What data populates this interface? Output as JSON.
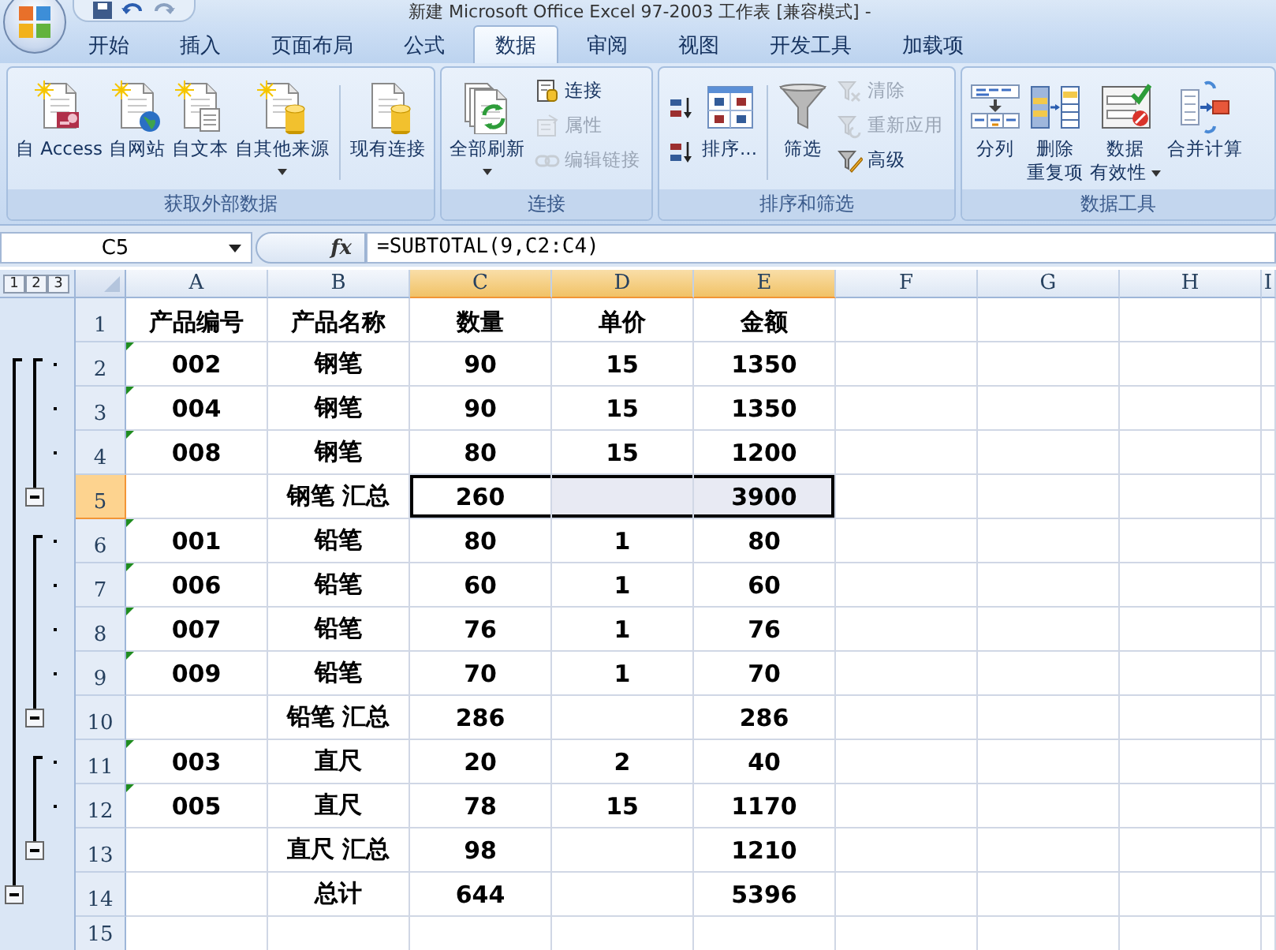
{
  "window": {
    "title": "新建 Microsoft Office Excel 97-2003 工作表 [兼容模式] -"
  },
  "tabs": [
    {
      "label": "开始",
      "selected": false
    },
    {
      "label": "插入",
      "selected": false
    },
    {
      "label": "页面布局",
      "selected": false
    },
    {
      "label": "公式",
      "selected": false
    },
    {
      "label": "数据",
      "selected": true
    },
    {
      "label": "审阅",
      "selected": false
    },
    {
      "label": "视图",
      "selected": false
    },
    {
      "label": "开发工具",
      "selected": false
    },
    {
      "label": "加载项",
      "selected": false
    }
  ],
  "ribbon_groups": [
    {
      "label": "获取外部数据",
      "items": [
        {
          "kind": "large",
          "label": [
            "自 Access"
          ],
          "dropdown": false
        },
        {
          "kind": "large",
          "label": [
            "自网站"
          ],
          "dropdown": false
        },
        {
          "kind": "large",
          "label": [
            "自文本"
          ],
          "dropdown": false
        },
        {
          "kind": "large",
          "label": [
            "自其他来源"
          ],
          "dropdown": true
        },
        {
          "kind": "large",
          "label": [
            "现有连接"
          ],
          "dropdown": false
        }
      ]
    },
    {
      "label": "连接",
      "items": [
        {
          "kind": "large",
          "label": [
            "全部刷新"
          ],
          "dropdown": true
        },
        {
          "kind": "stack",
          "buttons": [
            {
              "label": "连接",
              "disabled": false
            },
            {
              "label": "属性",
              "disabled": true
            },
            {
              "label": "编辑链接",
              "disabled": true
            }
          ]
        }
      ]
    },
    {
      "label": "排序和筛选",
      "items": [
        {
          "kind": "stack",
          "buttons": [
            {
              "disabled": false
            },
            {
              "disabled": false
            }
          ]
        },
        {
          "kind": "large",
          "label": [
            "排序..."
          ],
          "dropdown": false
        },
        {
          "kind": "large",
          "label": [
            "筛选"
          ],
          "dropdown": false
        },
        {
          "kind": "stack",
          "buttons": [
            {
              "label": "清除",
              "disabled": true
            },
            {
              "label": "重新应用",
              "disabled": true
            },
            {
              "label": "高级",
              "disabled": false
            }
          ]
        }
      ]
    },
    {
      "label": "数据工具",
      "items": [
        {
          "kind": "large",
          "label": [
            "分列"
          ],
          "dropdown": false
        },
        {
          "kind": "large",
          "label": [
            "删除",
            "重复项"
          ],
          "dropdown": false
        },
        {
          "kind": "large",
          "label": [
            "数据",
            "有效性"
          ],
          "dropdown": true
        },
        {
          "kind": "large",
          "label": [
            "合并计算"
          ],
          "dropdown": false
        }
      ]
    }
  ],
  "formula_bar": {
    "name_box": "C5",
    "function_button": "fx",
    "formula": "=SUBTOTAL(9,C2:C4)"
  },
  "sheet": {
    "outline_levels": [
      "1",
      "2",
      "3"
    ],
    "columns": [
      {
        "label": "A",
        "selected": false
      },
      {
        "label": "B",
        "selected": false
      },
      {
        "label": "C",
        "selected": true
      },
      {
        "label": "D",
        "selected": true
      },
      {
        "label": "E",
        "selected": true
      },
      {
        "label": "F",
        "selected": false
      },
      {
        "label": "G",
        "selected": false
      },
      {
        "label": "H",
        "selected": false
      },
      {
        "label": "I",
        "selected": false
      }
    ],
    "rows": [
      {
        "header": "1",
        "kind": "header",
        "selected": false,
        "text_number_flag": false,
        "cells": [
          "产品编号",
          "产品名称",
          "数量",
          "单价",
          "金额"
        ]
      },
      {
        "header": "2",
        "kind": "detail",
        "selected": false,
        "text_number_flag": true,
        "cells": [
          "002",
          "钢笔",
          "90",
          "15",
          "1350"
        ]
      },
      {
        "header": "3",
        "kind": "detail",
        "selected": false,
        "text_number_flag": true,
        "cells": [
          "004",
          "钢笔",
          "90",
          "15",
          "1350"
        ]
      },
      {
        "header": "4",
        "kind": "detail",
        "selected": false,
        "text_number_flag": true,
        "cells": [
          "008",
          "钢笔",
          "80",
          "15",
          "1200"
        ]
      },
      {
        "header": "5",
        "kind": "subtotal",
        "selected": true,
        "text_number_flag": false,
        "cells": [
          null,
          "钢笔 汇总",
          "260",
          null,
          "3900"
        ]
      },
      {
        "header": "6",
        "kind": "detail",
        "selected": false,
        "text_number_flag": true,
        "cells": [
          "001",
          "铅笔",
          "80",
          "1",
          "80"
        ]
      },
      {
        "header": "7",
        "kind": "detail",
        "selected": false,
        "text_number_flag": true,
        "cells": [
          "006",
          "铅笔",
          "60",
          "1",
          "60"
        ]
      },
      {
        "header": "8",
        "kind": "detail",
        "selected": false,
        "text_number_flag": true,
        "cells": [
          "007",
          "铅笔",
          "76",
          "1",
          "76"
        ]
      },
      {
        "header": "9",
        "kind": "detail",
        "selected": false,
        "text_number_flag": true,
        "cells": [
          "009",
          "铅笔",
          "70",
          "1",
          "70"
        ]
      },
      {
        "header": "10",
        "kind": "subtotal",
        "selected": false,
        "text_number_flag": false,
        "cells": [
          null,
          "铅笔 汇总",
          "286",
          null,
          "286"
        ]
      },
      {
        "header": "11",
        "kind": "detail",
        "selected": false,
        "text_number_flag": true,
        "cells": [
          "003",
          "直尺",
          "20",
          "2",
          "40"
        ]
      },
      {
        "header": "12",
        "kind": "detail",
        "selected": false,
        "text_number_flag": true,
        "cells": [
          "005",
          "直尺",
          "78",
          "15",
          "1170"
        ]
      },
      {
        "header": "13",
        "kind": "subtotal",
        "selected": false,
        "text_number_flag": false,
        "cells": [
          null,
          "直尺 汇总",
          "98",
          null,
          "1210"
        ]
      },
      {
        "header": "14",
        "kind": "total",
        "selected": false,
        "text_number_flag": false,
        "cells": [
          null,
          "总计",
          "644",
          null,
          "5396"
        ]
      },
      {
        "header": "15",
        "kind": "blank",
        "selected": false,
        "text_number_flag": false
      }
    ]
  }
}
